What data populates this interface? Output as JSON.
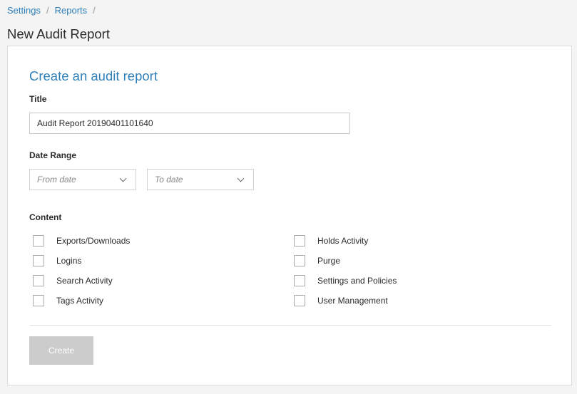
{
  "breadcrumb": {
    "items": [
      "Settings",
      "Reports"
    ],
    "separator": "/"
  },
  "page_title": "New Audit Report",
  "form": {
    "heading": "Create an audit report",
    "title_label": "Title",
    "title_value": "Audit Report 20190401101640",
    "date_range_label": "Date Range",
    "from_placeholder": "From date",
    "to_placeholder": "To date",
    "content_label": "Content",
    "content_options": [
      "Exports/Downloads",
      "Logins",
      "Search Activity",
      "Tags Activity",
      "Holds Activity",
      "Purge",
      "Settings and Policies",
      "User Management"
    ],
    "create_label": "Create"
  },
  "colors": {
    "accent": "#2f7fb8",
    "disabled_button": "#cccccc",
    "background": "#f4f4f4"
  },
  "icons": {
    "date_select": "chevron-down-icon"
  }
}
